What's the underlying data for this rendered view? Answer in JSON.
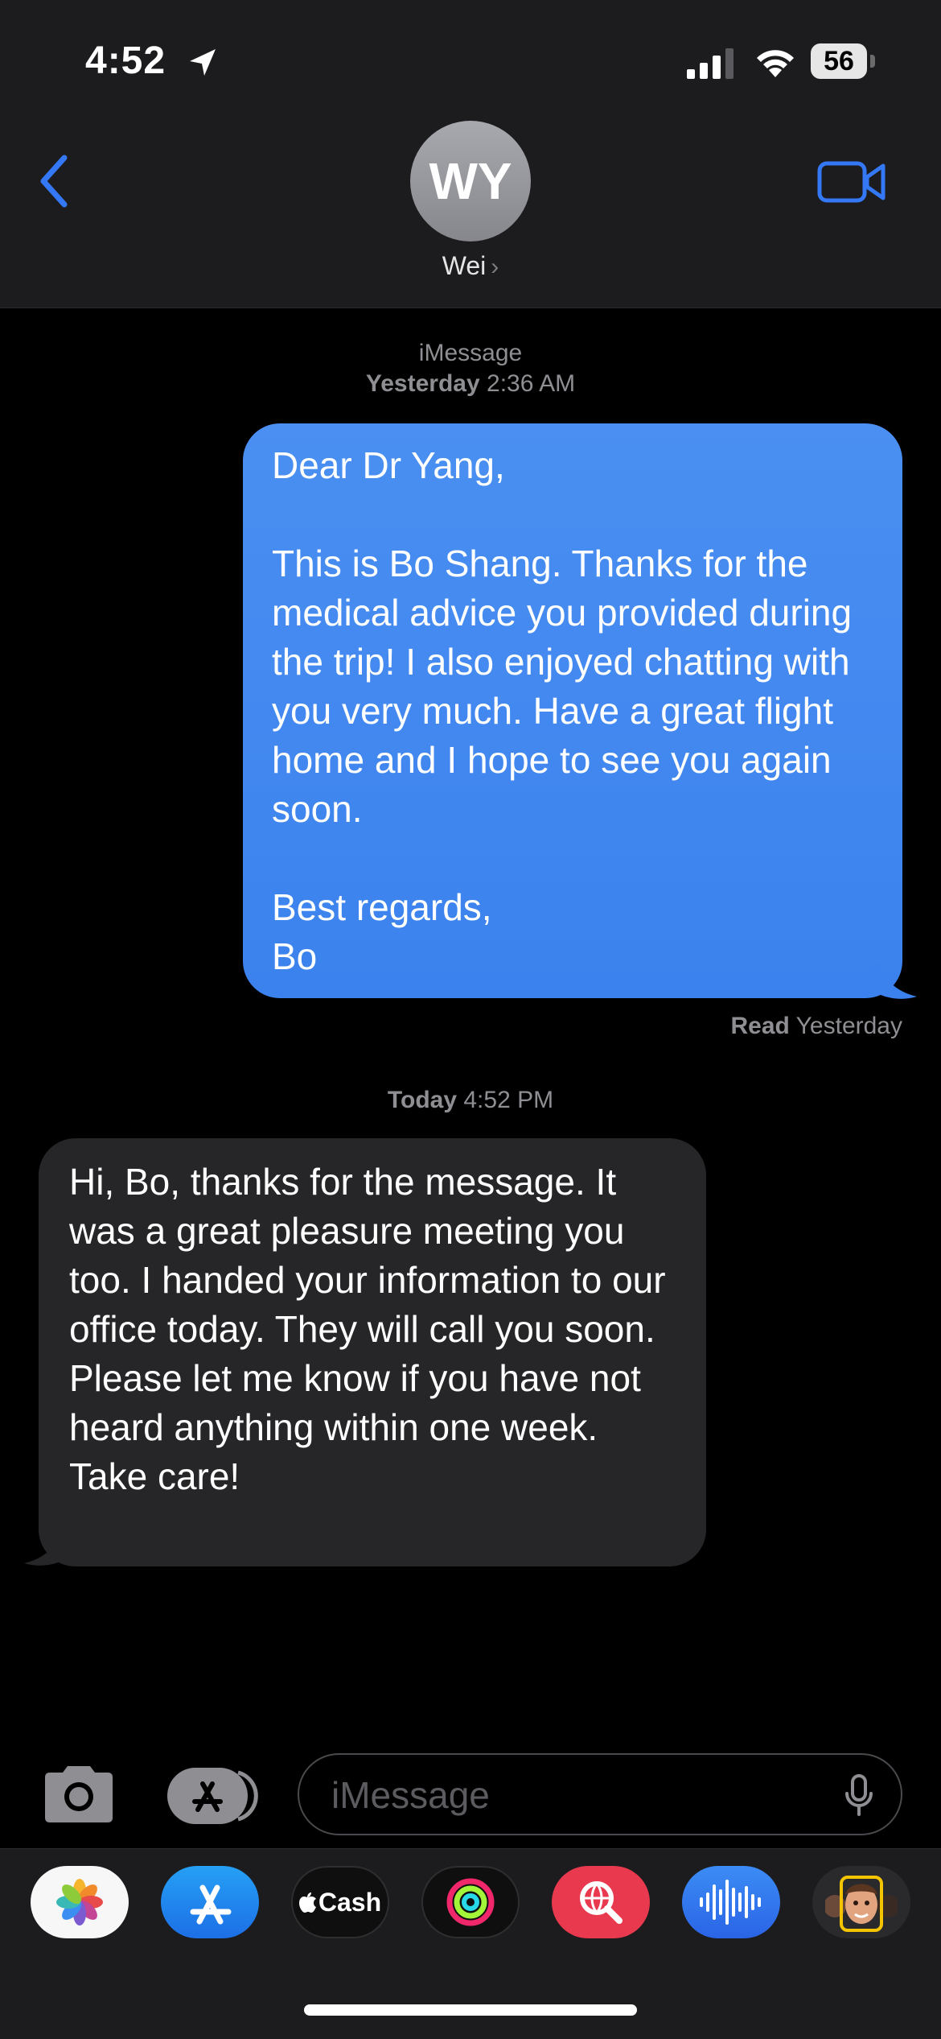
{
  "status_bar": {
    "time": "4:52",
    "battery": "56"
  },
  "contact": {
    "initials": "WY",
    "name": "Wei",
    "chevron": "›"
  },
  "conversation": {
    "header1": {
      "service": "iMessage",
      "day": "Yesterday",
      "time": "2:36 AM"
    },
    "sent_message": "Dear Dr Yang,\n\nThis is Bo Shang. Thanks for the medical advice you provided during the trip! I also enjoyed chatting with you very much. Have a great flight home and I hope to see you again soon.\n\nBest regards,\nBo",
    "read_receipt": {
      "label": "Read",
      "when": "Yesterday"
    },
    "header2": {
      "day": "Today",
      "time": "4:52 PM"
    },
    "received_message": "Hi, Bo, thanks for the message. It was a great pleasure meeting you too. I handed your information to our office today. They will call you soon. Please let me know if you have not heard anything within one week.  Take care!"
  },
  "composer": {
    "placeholder": "iMessage"
  },
  "app_drawer": {
    "apps": [
      {
        "name": "photos-icon"
      },
      {
        "name": "app-store-icon"
      },
      {
        "name": "apple-cash-icon",
        "label": "Cash"
      },
      {
        "name": "activity-icon"
      },
      {
        "name": "search-images-icon"
      },
      {
        "name": "audio-message-icon"
      },
      {
        "name": "memoji-icon"
      }
    ]
  },
  "colors": {
    "accent": "#3478f6",
    "sent_bubble": "#3b82ee",
    "received_bubble": "#262628",
    "header_bg": "#1c1c1e"
  }
}
